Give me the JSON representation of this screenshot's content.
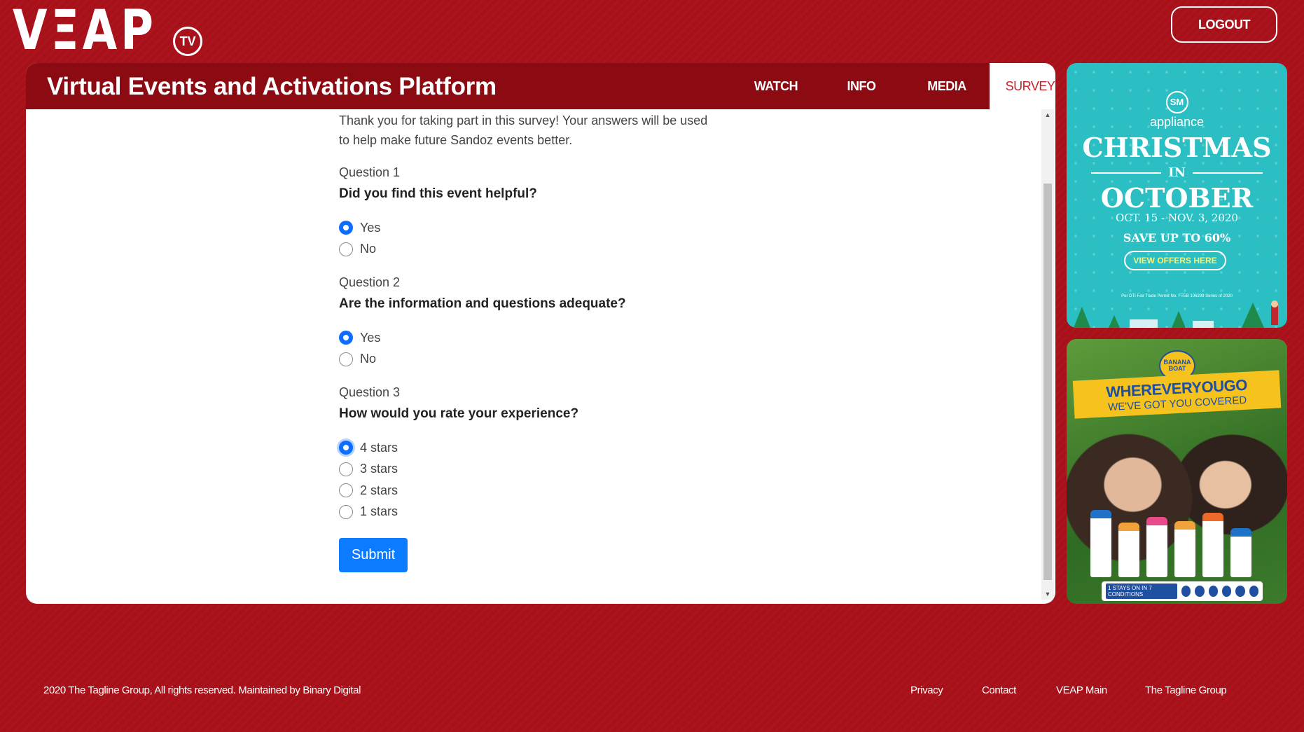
{
  "brand": {
    "logo_text": "VΞAP",
    "logo_badge": "TV"
  },
  "header": {
    "logout_label": "LOGOUT",
    "platform_title": "Virtual Events and Activations Platform"
  },
  "tabs": [
    {
      "label": "WATCH",
      "active": false
    },
    {
      "label": "INFO",
      "active": false
    },
    {
      "label": "MEDIA",
      "active": false
    },
    {
      "label": "SURVEY",
      "active": true
    }
  ],
  "survey": {
    "intro_line1": "Thank you for taking part in this survey! Your answers will be used",
    "intro_line2": "to help make future Sandoz events better.",
    "questions": [
      {
        "label": "Question 1",
        "text": "Did you find this event helpful?",
        "options": [
          "Yes",
          "No"
        ],
        "selected": 0
      },
      {
        "label": "Question 2",
        "text": "Are the information and questions adequate?",
        "options": [
          "Yes",
          "No"
        ],
        "selected": 0
      },
      {
        "label": "Question 3",
        "text": "How would you rate your experience?",
        "options": [
          "4 stars",
          "3 stars",
          "2 stars",
          "1 stars"
        ],
        "selected": 0
      }
    ],
    "submit_label": "Submit"
  },
  "ads": {
    "christmas": {
      "brand_badge": "SM",
      "brand": "appliance",
      "title": "CHRISTMAS",
      "in": "IN",
      "title2": "OCTOBER",
      "dates": "OCT. 15 - NOV. 3, 2020",
      "save": "SAVE UP TO 60%",
      "button": "VIEW OFFERS HERE",
      "fine_print": "Per DTI Fair Trade Permit No. FTEB 106299 Series of 2020"
    },
    "sunscreen": {
      "badge": "BANANA BOAT",
      "headline": "WHEREVERYOUGO",
      "subline": "WE'VE GOT YOU COVERED",
      "strip_text": "1 STAYS ON IN 7 CONDITIONS"
    }
  },
  "footer": {
    "copyright": "2020 The Tagline Group, All rights reserved. Maintained by Binary Digital",
    "links": [
      "Privacy",
      "Contact",
      "VEAP Main",
      "The Tagline Group"
    ]
  },
  "colors": {
    "background": "#a8111a",
    "header": "#8c0a12",
    "accent": "#0d6efd",
    "active_tab_text": "#c8202a"
  }
}
